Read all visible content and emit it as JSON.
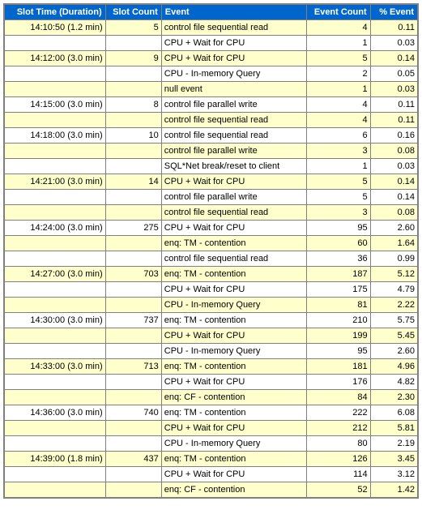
{
  "headers": {
    "slot": "Slot Time (Duration)",
    "slot_count": "Slot Count",
    "event": "Event",
    "event_count": "Event Count",
    "pct": "% Event"
  },
  "rows": [
    {
      "slot": "14:10:50 (1.2 min)",
      "slot_count": "5",
      "event": "control file sequential read",
      "event_count": "4",
      "pct": "0.11",
      "alt": "yel"
    },
    {
      "slot": "",
      "slot_count": "",
      "event": "CPU + Wait for CPU",
      "event_count": "1",
      "pct": "0.03",
      "alt": "wht"
    },
    {
      "slot": "14:12:00 (3.0 min)",
      "slot_count": "9",
      "event": "CPU + Wait for CPU",
      "event_count": "5",
      "pct": "0.14",
      "alt": "yel"
    },
    {
      "slot": "",
      "slot_count": "",
      "event": " CPU - In-memory Query",
      "event_count": "2",
      "pct": "0.05",
      "alt": "wht"
    },
    {
      "slot": "",
      "slot_count": "",
      "event": "null event",
      "event_count": "1",
      "pct": "0.03",
      "alt": "yel"
    },
    {
      "slot": "14:15:00 (3.0 min)",
      "slot_count": "8",
      "event": "control file parallel write",
      "event_count": "4",
      "pct": "0.11",
      "alt": "wht"
    },
    {
      "slot": "",
      "slot_count": "",
      "event": "control file sequential read",
      "event_count": "4",
      "pct": "0.11",
      "alt": "yel"
    },
    {
      "slot": "14:18:00 (3.0 min)",
      "slot_count": "10",
      "event": "control file sequential read",
      "event_count": "6",
      "pct": "0.16",
      "alt": "wht"
    },
    {
      "slot": "",
      "slot_count": "",
      "event": "control file parallel write",
      "event_count": "3",
      "pct": "0.08",
      "alt": "yel"
    },
    {
      "slot": "",
      "slot_count": "",
      "event": "SQL*Net break/reset to client",
      "event_count": "1",
      "pct": "0.03",
      "alt": "wht"
    },
    {
      "slot": "14:21:00 (3.0 min)",
      "slot_count": "14",
      "event": "CPU + Wait for CPU",
      "event_count": "5",
      "pct": "0.14",
      "alt": "yel"
    },
    {
      "slot": "",
      "slot_count": "",
      "event": "control file parallel write",
      "event_count": "5",
      "pct": "0.14",
      "alt": "wht"
    },
    {
      "slot": "",
      "slot_count": "",
      "event": "control file sequential read",
      "event_count": "3",
      "pct": "0.08",
      "alt": "yel"
    },
    {
      "slot": "14:24:00 (3.0 min)",
      "slot_count": "275",
      "event": "CPU + Wait for CPU",
      "event_count": "95",
      "pct": "2.60",
      "alt": "wht"
    },
    {
      "slot": "",
      "slot_count": "",
      "event": "enq: TM - contention",
      "event_count": "60",
      "pct": "1.64",
      "alt": "yel"
    },
    {
      "slot": "",
      "slot_count": "",
      "event": "control file sequential read",
      "event_count": "36",
      "pct": "0.99",
      "alt": "wht"
    },
    {
      "slot": "14:27:00 (3.0 min)",
      "slot_count": "703",
      "event": "enq: TM - contention",
      "event_count": "187",
      "pct": "5.12",
      "alt": "yel"
    },
    {
      "slot": "",
      "slot_count": "",
      "event": "CPU + Wait for CPU",
      "event_count": "175",
      "pct": "4.79",
      "alt": "wht"
    },
    {
      "slot": "",
      "slot_count": "",
      "event": " CPU - In-memory Query",
      "event_count": "81",
      "pct": "2.22",
      "alt": "yel"
    },
    {
      "slot": "14:30:00 (3.0 min)",
      "slot_count": "737",
      "event": "enq: TM - contention",
      "event_count": "210",
      "pct": "5.75",
      "alt": "wht"
    },
    {
      "slot": "",
      "slot_count": "",
      "event": "CPU + Wait for CPU",
      "event_count": "199",
      "pct": "5.45",
      "alt": "yel"
    },
    {
      "slot": "",
      "slot_count": "",
      "event": " CPU - In-memory Query",
      "event_count": "95",
      "pct": "2.60",
      "alt": "wht"
    },
    {
      "slot": "14:33:00 (3.0 min)",
      "slot_count": "713",
      "event": "enq: TM - contention",
      "event_count": "181",
      "pct": "4.96",
      "alt": "yel"
    },
    {
      "slot": "",
      "slot_count": "",
      "event": "CPU + Wait for CPU",
      "event_count": "176",
      "pct": "4.82",
      "alt": "wht"
    },
    {
      "slot": "",
      "slot_count": "",
      "event": "enq: CF - contention",
      "event_count": "84",
      "pct": "2.30",
      "alt": "yel"
    },
    {
      "slot": "14:36:00 (3.0 min)",
      "slot_count": "740",
      "event": "enq: TM - contention",
      "event_count": "222",
      "pct": "6.08",
      "alt": "wht"
    },
    {
      "slot": "",
      "slot_count": "",
      "event": "CPU + Wait for CPU",
      "event_count": "212",
      "pct": "5.81",
      "alt": "yel"
    },
    {
      "slot": "",
      "slot_count": "",
      "event": " CPU - In-memory Query",
      "event_count": "80",
      "pct": "2.19",
      "alt": "wht"
    },
    {
      "slot": "14:39:00 (1.8 min)",
      "slot_count": "437",
      "event": "enq: TM - contention",
      "event_count": "126",
      "pct": "3.45",
      "alt": "yel"
    },
    {
      "slot": "",
      "slot_count": "",
      "event": "CPU + Wait for CPU",
      "event_count": "114",
      "pct": "3.12",
      "alt": "wht"
    },
    {
      "slot": "",
      "slot_count": "",
      "event": "enq: CF - contention",
      "event_count": "52",
      "pct": "1.42",
      "alt": "yel"
    }
  ]
}
